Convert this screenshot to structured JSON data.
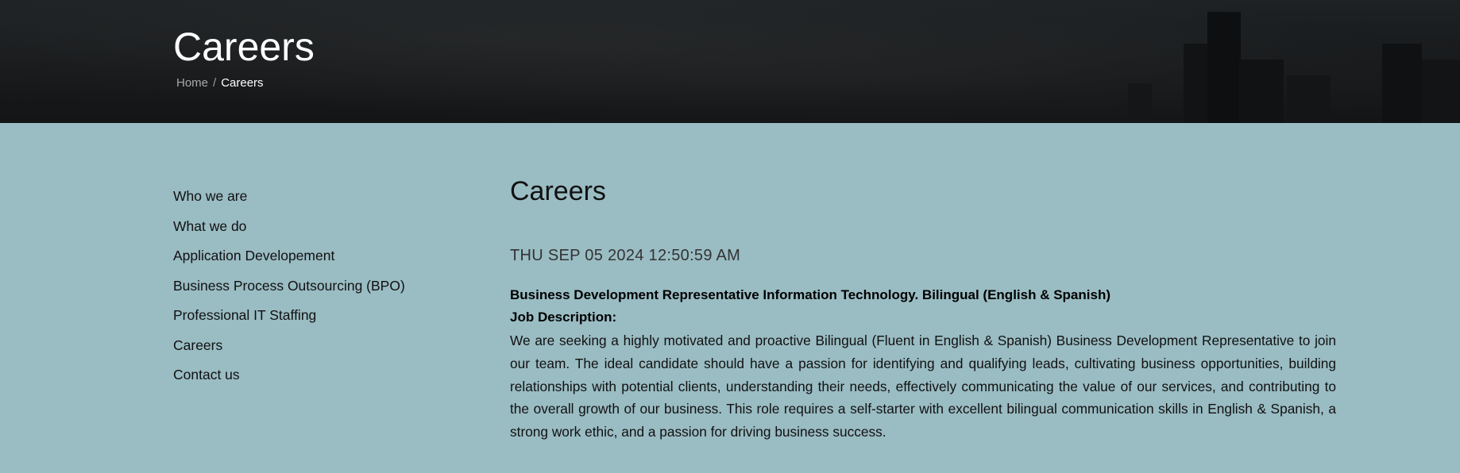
{
  "hero": {
    "title": "Careers",
    "breadcrumb": {
      "home": "Home",
      "separator": "/",
      "current": "Careers"
    }
  },
  "sidebar": {
    "items": [
      {
        "label": "Who we are"
      },
      {
        "label": "What we do"
      },
      {
        "label": "Application Developement"
      },
      {
        "label": "Business Process Outsourcing (BPO)"
      },
      {
        "label": "Professional IT Staffing"
      },
      {
        "label": "Careers"
      },
      {
        "label": "Contact us"
      }
    ]
  },
  "main": {
    "heading": "Careers",
    "date": "THU SEP 05 2024 12:50:59 AM",
    "job_title": "Business Development Representative Information Technology. Bilingual (English & Spanish)",
    "job_desc_label": "Job Description:",
    "job_body": "We are seeking a highly motivated and proactive Bilingual (Fluent in English & Spanish) Business Development Representative to join our team. The ideal candidate should have a passion for identifying and qualifying leads, cultivating business opportunities, building relationships with potential clients, understanding their needs, effectively communicating the value of our services, and contributing to the overall growth of our business. This role requires a self-starter with excellent bilingual communication skills in English & Spanish, a strong work ethic, and a passion for driving business success."
  },
  "colors": {
    "content_background": "#9abcc3",
    "hero_background": "#17191b",
    "hero_text": "#ffffff"
  }
}
